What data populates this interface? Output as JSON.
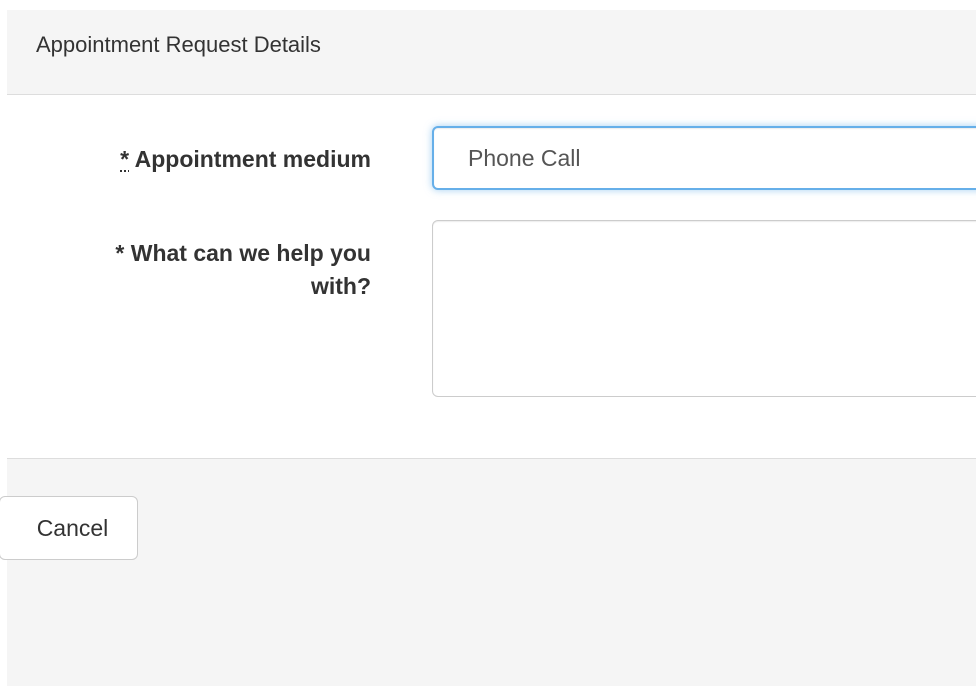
{
  "panel": {
    "title": "Appointment Request Details"
  },
  "form": {
    "medium": {
      "required_marker": "*",
      "label": " Appointment medium",
      "selected_value": "Phone Call"
    },
    "help": {
      "label": "* What can we help you with?",
      "value": ""
    }
  },
  "footer": {
    "cancel_label": "Cancel"
  },
  "colors": {
    "focus_border": "#66afe9",
    "panel_background": "#f5f5f5",
    "border": "#dddddd"
  }
}
